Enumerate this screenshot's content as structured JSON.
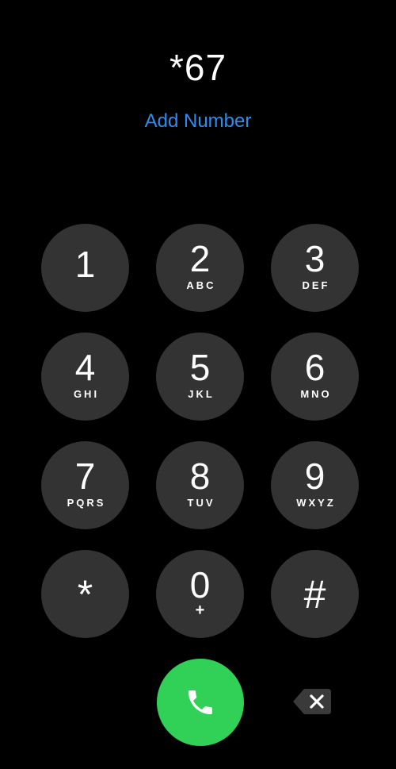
{
  "dialer": {
    "display": "*67",
    "add_number": "Add Number"
  },
  "keypad": {
    "keys": [
      {
        "digit": "1",
        "letters": ""
      },
      {
        "digit": "2",
        "letters": "ABC"
      },
      {
        "digit": "3",
        "letters": "DEF"
      },
      {
        "digit": "4",
        "letters": "GHI"
      },
      {
        "digit": "5",
        "letters": "JKL"
      },
      {
        "digit": "6",
        "letters": "MNO"
      },
      {
        "digit": "7",
        "letters": "PQRS"
      },
      {
        "digit": "8",
        "letters": "TUV"
      },
      {
        "digit": "9",
        "letters": "WXYZ"
      },
      {
        "digit": "*",
        "letters": ""
      },
      {
        "digit": "0",
        "letters": "+"
      },
      {
        "digit": "#",
        "letters": ""
      }
    ]
  },
  "icons": {
    "call": "phone-icon",
    "delete": "backspace-icon"
  },
  "colors": {
    "background": "#000000",
    "key": "#333333",
    "accent_link": "#2d8cf0",
    "call_green": "#31d158",
    "text": "#ffffff"
  }
}
